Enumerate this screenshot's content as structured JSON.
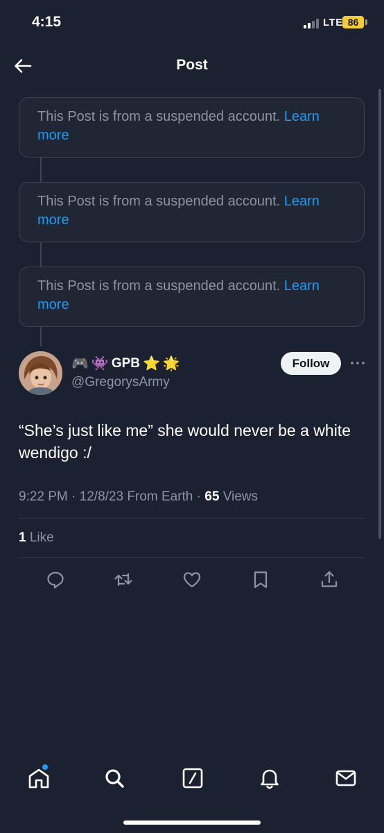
{
  "status_bar": {
    "time": "4:15",
    "network": "LTE",
    "battery": "86"
  },
  "header": {
    "title": "Post"
  },
  "suspended_notice": {
    "text": "This Post is from a suspended account.",
    "link": "Learn more"
  },
  "author": {
    "emojis": [
      "🎮",
      "👾"
    ],
    "name": "GPB",
    "badge_emojis": [
      "⭐",
      "🌟"
    ],
    "handle": "@GregorysArmy",
    "follow_label": "Follow"
  },
  "tweet": {
    "text": "“She’s just like me” she would never be a white wendigo :/",
    "time": "9:22 PM",
    "date": "12/8/23",
    "location": "From Earth",
    "views_count": "65",
    "views_label": "Views",
    "likes_count": "1",
    "likes_label": "Like"
  },
  "icons": {
    "back": "arrow-left-icon",
    "more": "more-horizontal-icon",
    "actions": [
      "reply-icon",
      "retweet-icon",
      "like-icon",
      "bookmark-icon",
      "share-icon"
    ],
    "tabs": [
      "home-icon",
      "search-icon",
      "grok-icon",
      "notifications-icon",
      "messages-icon"
    ]
  },
  "colors": {
    "background": "#1b2130",
    "accent": "#1d9bf0",
    "muted": "#8b95a1",
    "battery": "#f2cc3a"
  }
}
